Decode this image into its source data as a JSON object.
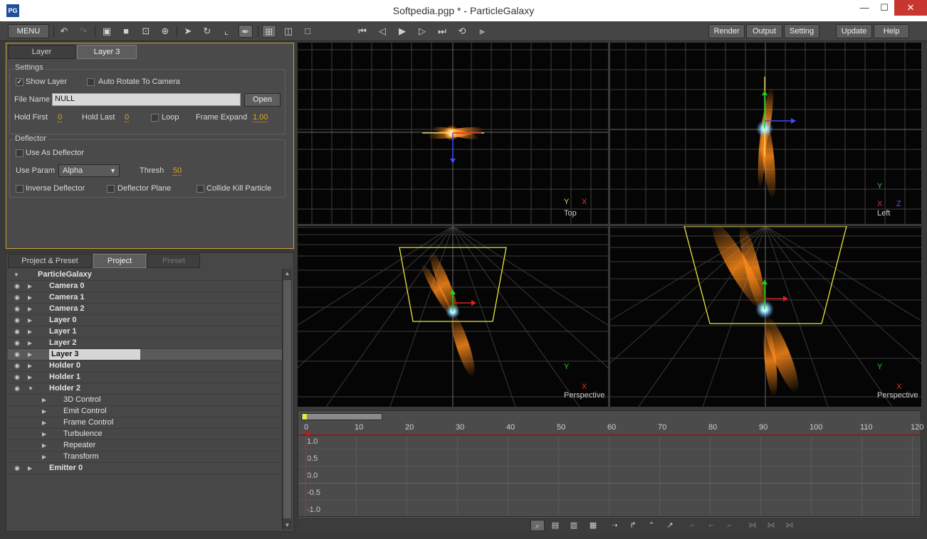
{
  "window": {
    "title": "Softpedia.pgp * - ParticleGalaxy",
    "app_icon": "PG",
    "minimize": "—",
    "maximize": "☐",
    "close": "✕"
  },
  "toolbar": {
    "menu_label": "MENU",
    "render_label": "Render",
    "output_label": "Output",
    "setting_label": "Setting",
    "update_label": "Update",
    "help_label": "Help"
  },
  "props": {
    "tabs": [
      "Layer",
      "Layer 3"
    ],
    "settings_title": "Settings",
    "show_layer_label": "Show Layer",
    "show_layer_checked": true,
    "auto_rotate_label": "Auto Rotate To Camera",
    "file_name_label": "File Name",
    "file_name_value": "NULL",
    "open_label": "Open",
    "hold_first_label": "Hold First",
    "hold_first_value": "0",
    "hold_last_label": "Hold Last",
    "hold_last_value": "0",
    "loop_label": "Loop",
    "frame_expand_label": "Frame Expand",
    "frame_expand_value": "1.00",
    "deflector_title": "Deflector",
    "use_as_deflector_label": "Use As Deflector",
    "use_param_label": "Use Param",
    "use_param_value": "Alpha",
    "thresh_label": "Thresh",
    "thresh_value": "50",
    "inverse_deflector_label": "Inverse Deflector",
    "deflector_plane_label": "Deflector Plane",
    "collide_kill_label": "Collide Kill Particle"
  },
  "tree": {
    "tabs": [
      "Project & Preset",
      "Project",
      "Preset"
    ],
    "root": "ParticleGalaxy",
    "items": [
      {
        "name": "Camera 0",
        "eye": true,
        "expanded": false,
        "level": 1,
        "bold": true
      },
      {
        "name": "Camera 1",
        "eye": true,
        "expanded": false,
        "level": 1,
        "bold": true
      },
      {
        "name": "Camera 2",
        "eye": true,
        "expanded": false,
        "level": 1,
        "bold": true
      },
      {
        "name": "Layer 0",
        "eye": true,
        "expanded": false,
        "level": 1,
        "bold": true
      },
      {
        "name": "Layer 1",
        "eye": true,
        "expanded": false,
        "level": 1,
        "bold": true
      },
      {
        "name": "Layer 2",
        "eye": true,
        "expanded": false,
        "level": 1,
        "bold": true
      },
      {
        "name": "Layer 3",
        "eye": true,
        "expanded": false,
        "level": 1,
        "bold": true,
        "selected": true
      },
      {
        "name": "Holder 0",
        "eye": true,
        "expanded": false,
        "level": 1,
        "bold": true
      },
      {
        "name": "Holder 1",
        "eye": true,
        "expanded": false,
        "level": 1,
        "bold": true
      },
      {
        "name": "Holder 2",
        "eye": true,
        "expanded": true,
        "level": 1,
        "bold": true
      },
      {
        "name": "3D Control",
        "eye": false,
        "expanded": false,
        "level": 2,
        "bold": false
      },
      {
        "name": "Emit Control",
        "eye": false,
        "expanded": false,
        "level": 2,
        "bold": false
      },
      {
        "name": "Frame Control",
        "eye": false,
        "expanded": false,
        "level": 2,
        "bold": false
      },
      {
        "name": "Turbulence",
        "eye": false,
        "expanded": false,
        "level": 2,
        "bold": false
      },
      {
        "name": "Repeater",
        "eye": false,
        "expanded": false,
        "level": 2,
        "bold": false
      },
      {
        "name": "Transform",
        "eye": false,
        "expanded": false,
        "level": 2,
        "bold": false
      },
      {
        "name": "Emitter 0",
        "eye": true,
        "expanded": false,
        "level": 1,
        "bold": true
      }
    ]
  },
  "viewports": {
    "top": {
      "label": "Top",
      "axis_a": "Y",
      "axis_b": "X"
    },
    "left": {
      "label": "Left",
      "axis_a": "Y",
      "axis_b": "X",
      "axis_c": "Z"
    },
    "persp1": {
      "label": "Perspective",
      "axis_a": "Y",
      "axis_b": "X"
    },
    "persp2": {
      "label": "Perspective",
      "axis_a": "Y",
      "axis_b": "X"
    }
  },
  "timeline": {
    "frames": [
      "0",
      "10",
      "20",
      "30",
      "40",
      "50",
      "60",
      "70",
      "80",
      "90",
      "100",
      "110",
      "120"
    ],
    "values": [
      "1.0",
      "0.5",
      "0.0",
      "-0.5",
      "-1.0"
    ]
  },
  "colors": {
    "accent": "#c9a233",
    "value": "#e2a21c",
    "close": "#c7372f"
  }
}
